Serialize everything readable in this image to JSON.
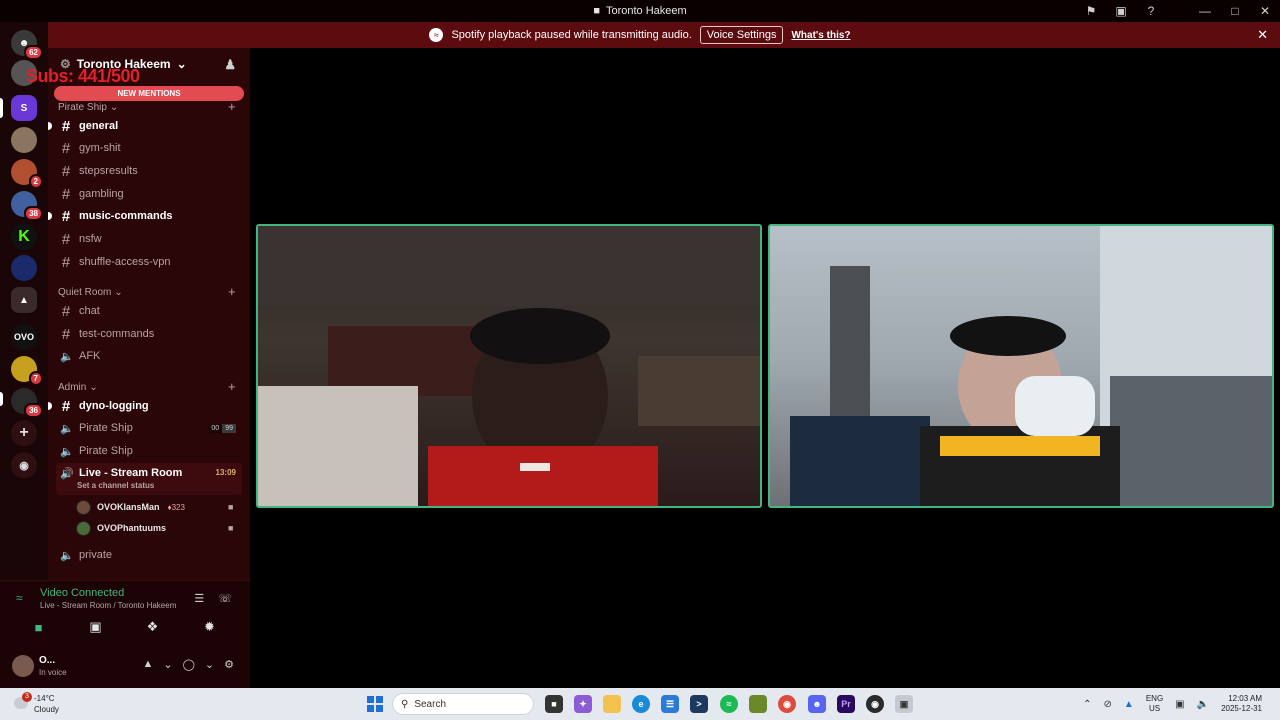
{
  "window": {
    "title": "Toronto Hakeem"
  },
  "notice": {
    "text": "Spotify playback paused while transmitting audio.",
    "button": "Voice Settings",
    "link": "What's this?"
  },
  "rail": {
    "home_badge": "62",
    "badges": [
      "2",
      "38",
      "7",
      "36"
    ],
    "ovo_label": "OVO"
  },
  "server": {
    "name": "Toronto Hakeem",
    "overlay_subs": "Subs: 441/500",
    "new_mentions": "NEW MENTIONS"
  },
  "categories": [
    {
      "name": "Pirate Ship"
    },
    {
      "name": "Quiet Room"
    },
    {
      "name": "Admin"
    }
  ],
  "channels": {
    "general": "general",
    "gym": "gym-shit",
    "steps": "stepsresults",
    "gambling": "gambling",
    "music": "music-commands",
    "nsfw": "nsfw",
    "shuffle": "shuffle-access-vpn",
    "chat": "chat",
    "test": "test-commands",
    "afk": "AFK",
    "dyno": "dyno-logging",
    "pirate1": "Pirate Ship",
    "pirate1_limit_a": "00",
    "pirate1_limit_b": "99",
    "pirate2": "Pirate Ship",
    "stream": "Live - Stream Room",
    "stream_timer": "13:09",
    "stream_status": "Set a channel status",
    "private": "private"
  },
  "voice_users": [
    {
      "name": "OVOKlansMan",
      "boost": "323"
    },
    {
      "name": "OVOPhantuums"
    }
  ],
  "voice_panel": {
    "title": "Video Connected",
    "subtitle": "Live - Stream Room / Toronto Hakeem"
  },
  "user": {
    "name": "O...",
    "status": "In voice"
  },
  "taskbar": {
    "temp": "-14°C",
    "condition": "Cloudy",
    "weather_badge": "3",
    "search_placeholder": "Search",
    "lang_top": "ENG",
    "lang_bottom": "US",
    "time": "12:03 AM",
    "date": "2025-12-31",
    "premiere_label": "Pr"
  },
  "colors": {
    "accent_green": "#43b581",
    "sidebar_bg": "#2a0608",
    "notice_bg": "#5c0b0f",
    "mention_red": "#e34b52"
  }
}
